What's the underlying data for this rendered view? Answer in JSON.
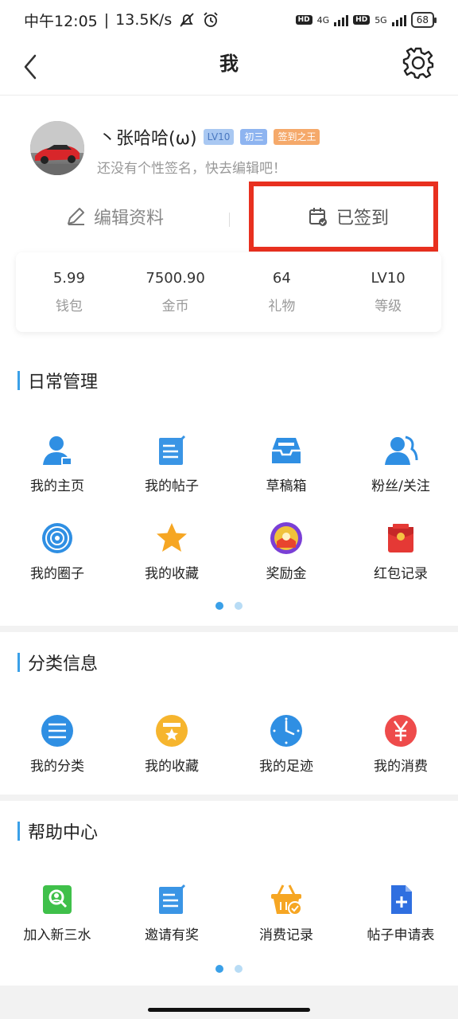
{
  "status_bar": {
    "time": "中午12:05",
    "speed": "13.5K/s",
    "net1": "4G",
    "net2": "5G",
    "hd": "HD",
    "battery": "68"
  },
  "nav": {
    "title": "我"
  },
  "profile": {
    "name": "丶张哈哈(ω)",
    "tags": [
      "LV10",
      "初三",
      "签到之王"
    ],
    "signature": "还没有个性签名，快去编辑吧！",
    "edit_label": "编辑资料",
    "sign_label": "已签到"
  },
  "stats": [
    {
      "value": "5.99",
      "label": "钱包"
    },
    {
      "value": "7500.90",
      "label": "金币"
    },
    {
      "value": "64",
      "label": "礼物"
    },
    {
      "value": "LV10",
      "label": "等级"
    }
  ],
  "daily": {
    "title": "日常管理",
    "items": [
      {
        "label": "我的主页",
        "icon": "user-home-icon"
      },
      {
        "label": "我的帖子",
        "icon": "post-icon"
      },
      {
        "label": "草稿箱",
        "icon": "draft-box-icon"
      },
      {
        "label": "粉丝/关注",
        "icon": "followers-icon"
      },
      {
        "label": "我的圈子",
        "icon": "circle-icon"
      },
      {
        "label": "我的收藏",
        "icon": "star-icon"
      },
      {
        "label": "奖励金",
        "icon": "reward-icon"
      },
      {
        "label": "红包记录",
        "icon": "red-packet-icon"
      }
    ]
  },
  "category": {
    "title": "分类信息",
    "items": [
      {
        "label": "我的分类",
        "icon": "category-list-icon"
      },
      {
        "label": "我的收藏",
        "icon": "collection-box-icon"
      },
      {
        "label": "我的足迹",
        "icon": "clock-icon"
      },
      {
        "label": "我的消费",
        "icon": "yuan-icon"
      }
    ]
  },
  "help": {
    "title": "帮助中心",
    "items": [
      {
        "label": "加入新三水",
        "icon": "join-icon"
      },
      {
        "label": "邀请有奖",
        "icon": "invite-icon"
      },
      {
        "label": "消费记录",
        "icon": "basket-icon"
      },
      {
        "label": "帖子申请表",
        "icon": "application-form-icon"
      }
    ]
  },
  "colors": {
    "accent": "#3aa0e8",
    "highlight": "#e8301f"
  }
}
